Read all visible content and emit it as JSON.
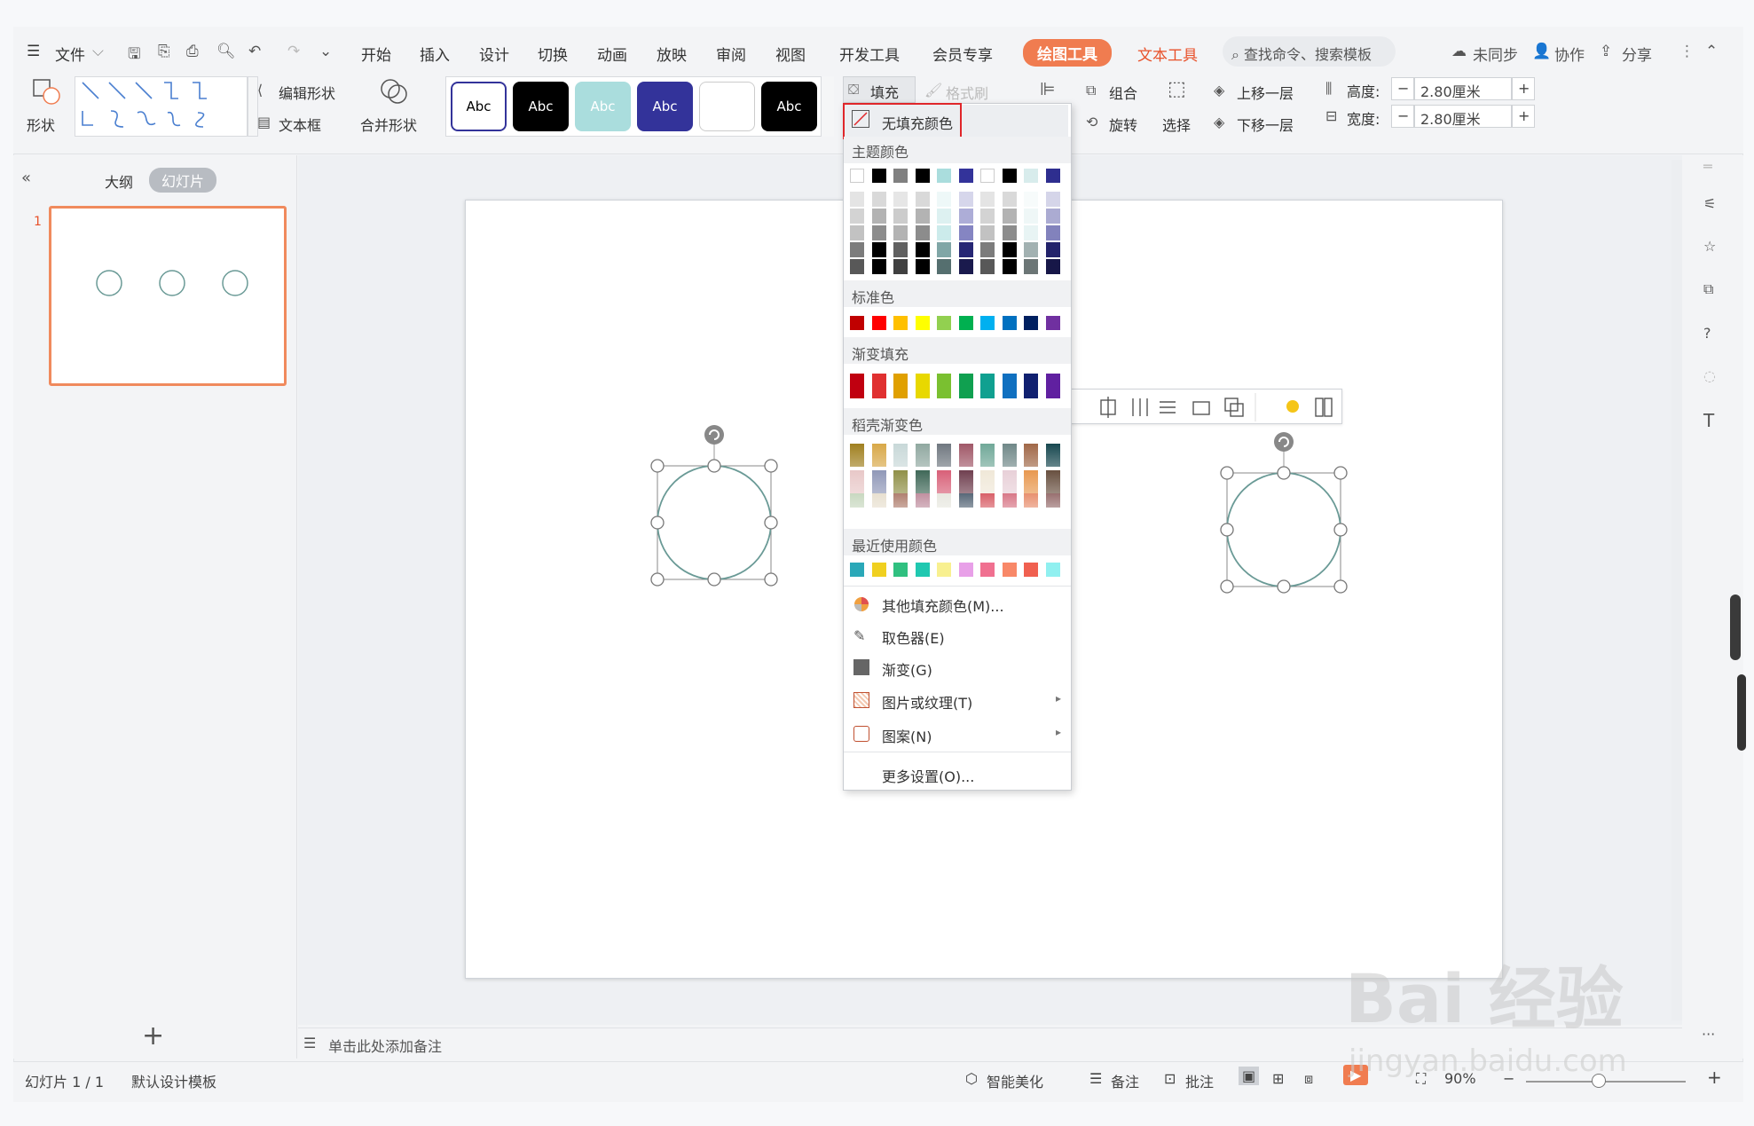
{
  "menu": {
    "file": "文件",
    "tabs": [
      "开始",
      "插入",
      "设计",
      "切换",
      "动画",
      "放映",
      "审阅",
      "视图",
      "开发工具",
      "会员专享"
    ],
    "drawing_tools": "绘图工具",
    "text_tools": "文本工具",
    "search_placeholder": "查找命令、搜索模板",
    "unsync": "未同步",
    "collab": "协作",
    "share": "分享"
  },
  "ribbon": {
    "shape": "形状",
    "edit_shape": "编辑形状",
    "text_box": "文本框",
    "merge_shape": "合并形状",
    "style_label": "Abc",
    "fill": "填充",
    "format_brush": "格式刷",
    "group": "组合",
    "rotate": "旋转",
    "select": "选择",
    "bring_forward": "上移一层",
    "send_backward": "下移一层",
    "height_label": "高度:",
    "width_label": "宽度:",
    "height_value": "2.80厘米",
    "width_value": "2.80厘米"
  },
  "left_panel": {
    "tab_outline": "大纲",
    "tab_slides": "幻灯片",
    "slide_number": "1"
  },
  "notes_placeholder": "单击此处添加备注",
  "status": {
    "slide_count": "幻灯片 1 / 1",
    "template": "默认设计模板",
    "beautify": "智能美化",
    "notes": "备注",
    "comments": "批注",
    "zoom": "90%"
  },
  "dropdown": {
    "no_fill": "无填充颜色",
    "theme_colors": "主题颜色",
    "standard_colors": "标准色",
    "gradient_fill": "渐变填充",
    "docer_gradient": "稻壳渐变色",
    "recent_colors": "最近使用颜色",
    "items": [
      "其他填充颜色(M)...",
      "取色器(E)",
      "渐变(G)",
      "图片或纹理(T)",
      "图案(N)",
      "更多设置(O)..."
    ],
    "theme_top": [
      "#ffffff",
      "#000000",
      "#808080",
      "#000000",
      "#aadddd",
      "#33339a",
      "#ffffff",
      "#000000",
      "#d8ecec",
      "#2e2e8f"
    ],
    "standard": [
      "#c00000",
      "#ff0000",
      "#ffc000",
      "#ffff00",
      "#92d050",
      "#00b050",
      "#00b0f0",
      "#0070c0",
      "#002060",
      "#7030a0"
    ],
    "gradients": [
      "#c00010",
      "#e03030",
      "#e0a000",
      "#e8d800",
      "#7ac030",
      "#10a050",
      "#10a090",
      "#1070c0",
      "#102070",
      "#6020a0"
    ],
    "recent": [
      "#2aa8b8",
      "#f0d020",
      "#30c080",
      "#20c8b0",
      "#f8f090",
      "#e8a0e8",
      "#f07090",
      "#f88868",
      "#f06050",
      "#90f0f0"
    ]
  },
  "watermark": "Bai 经验",
  "watermark_url": "jingyan.baidu.com"
}
